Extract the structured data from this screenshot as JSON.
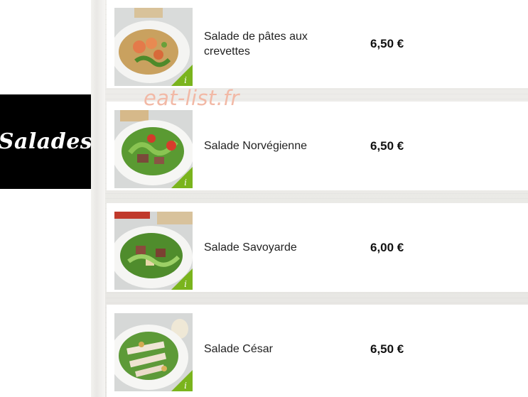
{
  "category": {
    "label": "Salades"
  },
  "watermark": "eat-list.fr",
  "items": [
    {
      "name": "Salade de pâtes aux crevettes",
      "price": "6,50 €",
      "info_icon": "info-icon"
    },
    {
      "name": "Salade Norvégienne",
      "price": "6,50 €",
      "info_icon": "info-icon"
    },
    {
      "name": "Salade Savoyarde",
      "price": "6,00 €",
      "info_icon": "info-icon"
    },
    {
      "name": "Salade César",
      "price": "6,50 €",
      "info_icon": "info-icon"
    }
  ],
  "colors": {
    "badge": "#7ab41d",
    "tab": "#000000"
  }
}
